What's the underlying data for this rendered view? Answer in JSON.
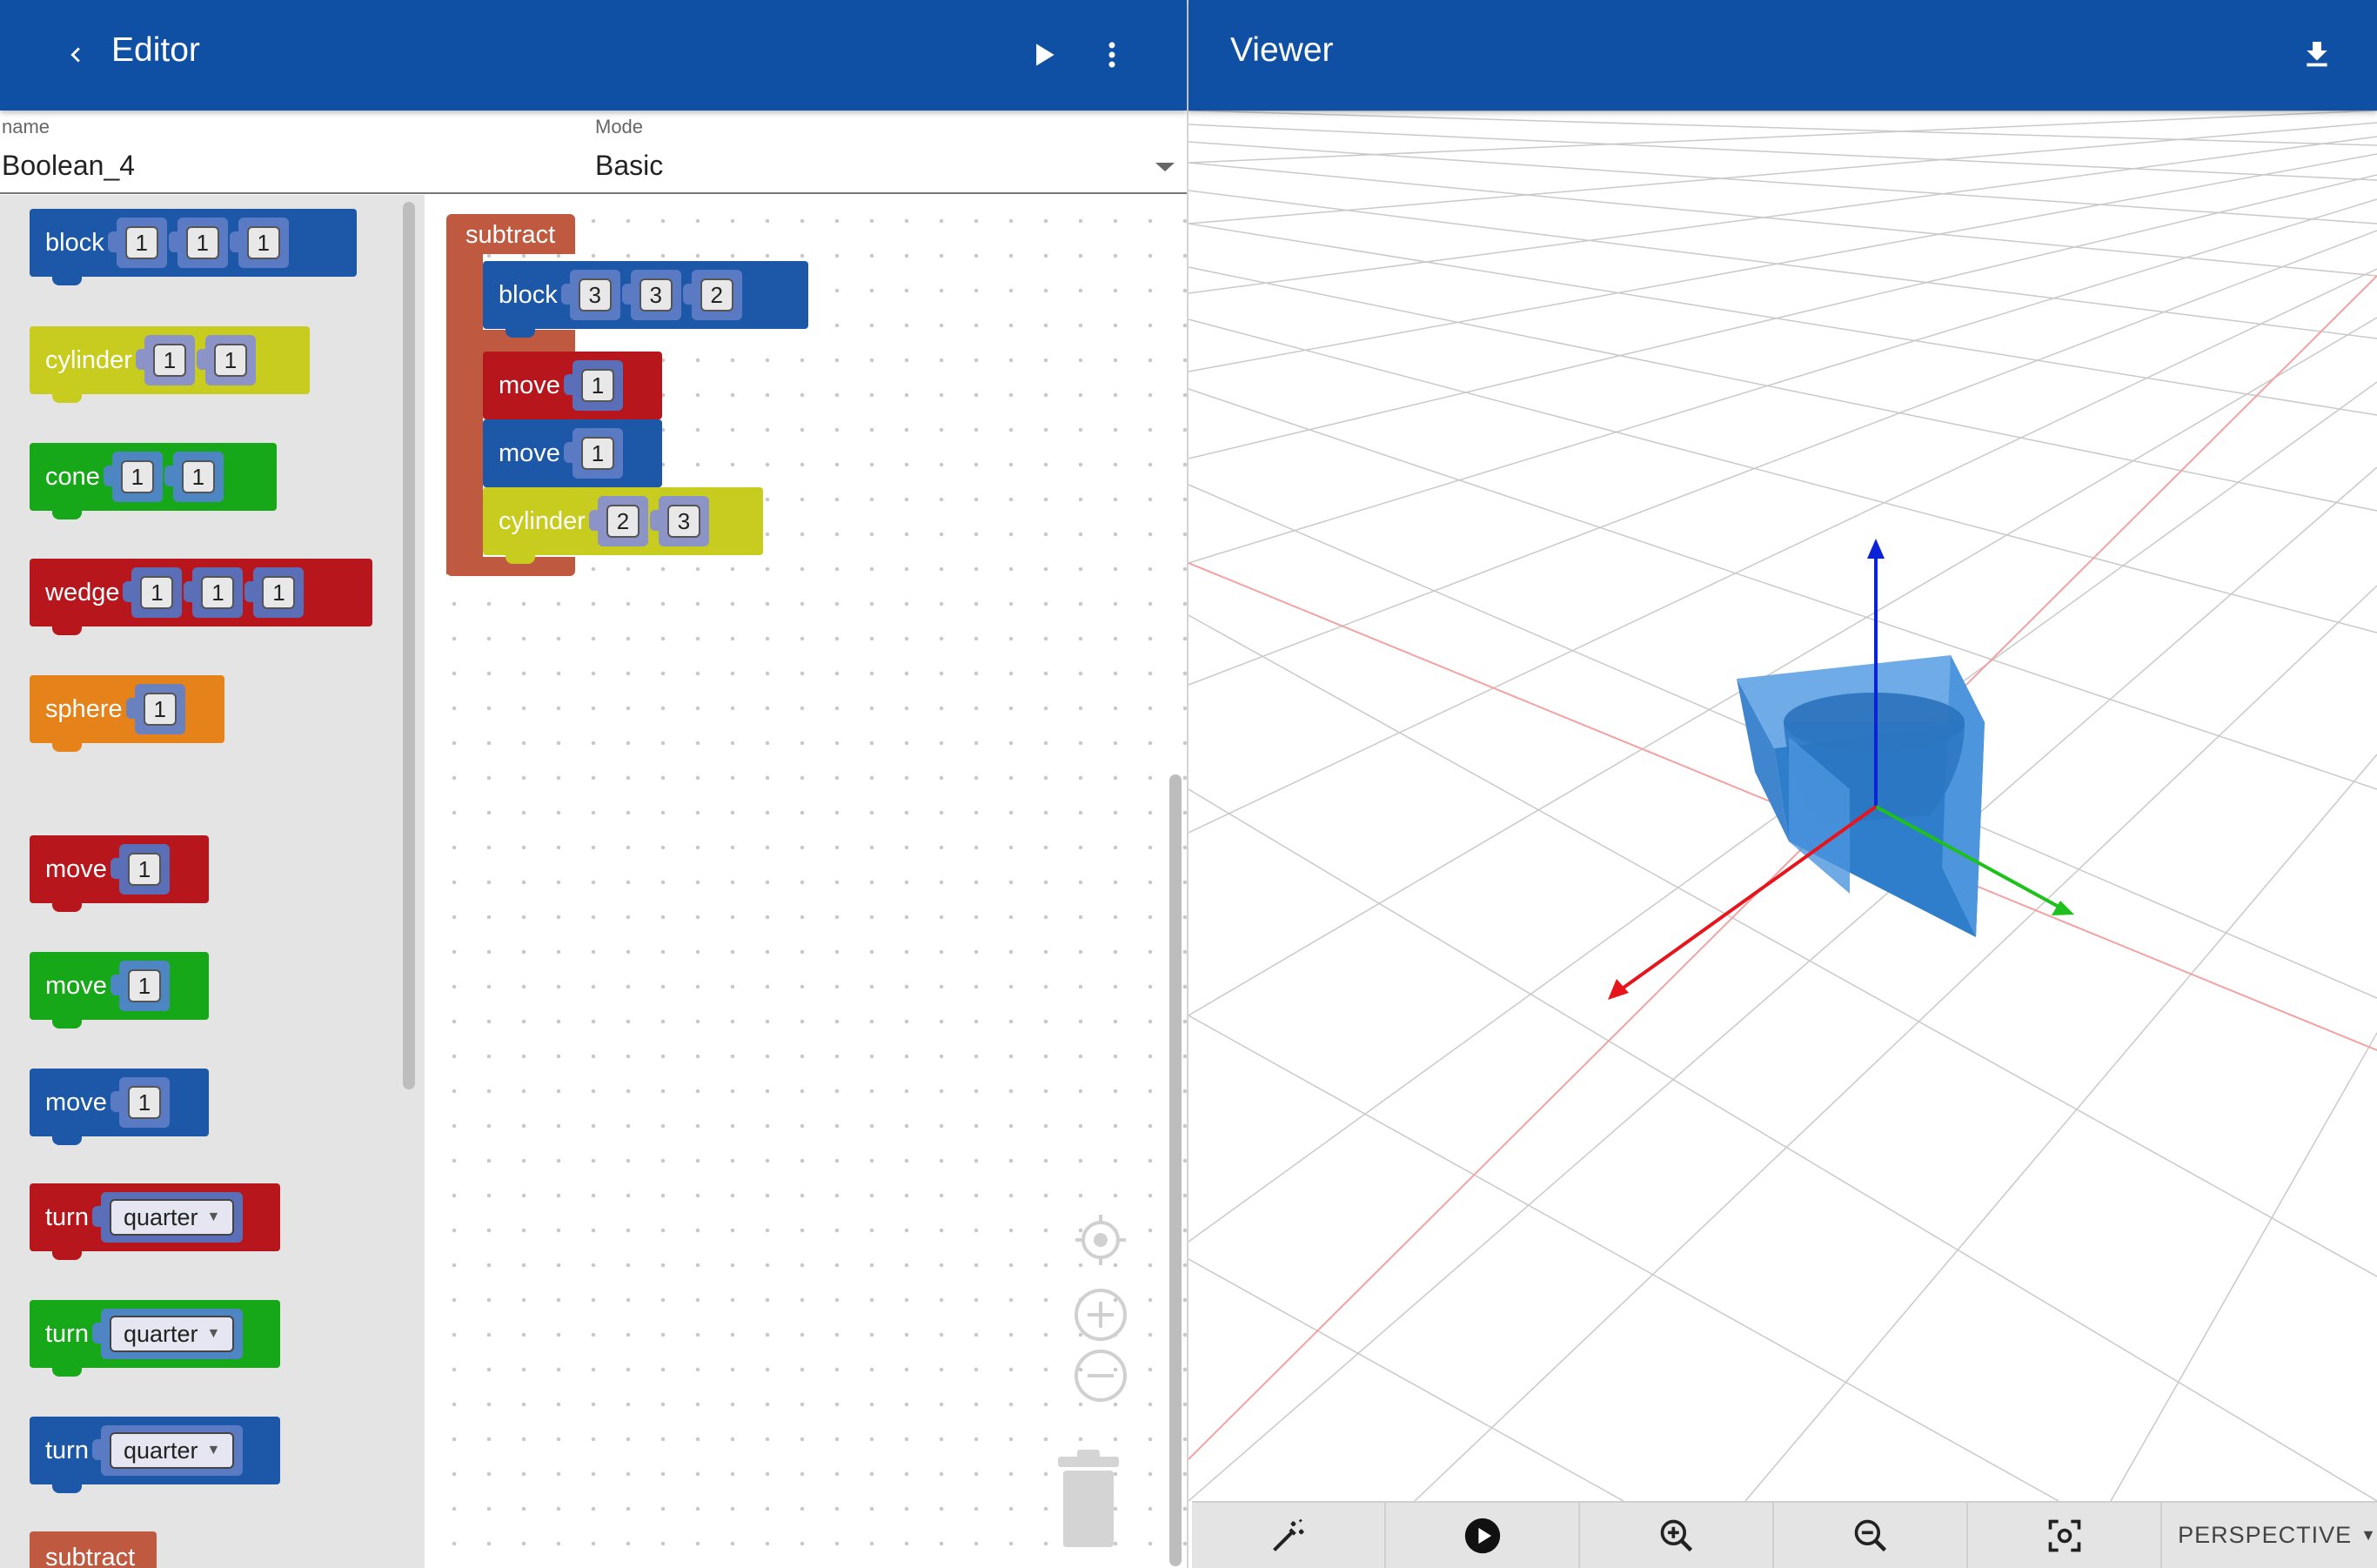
{
  "editor": {
    "title": "Editor",
    "name_field": {
      "label": "name",
      "value": "Boolean_4"
    },
    "mode_field": {
      "label": "Mode",
      "value": "Basic"
    },
    "toolbox": [
      {
        "label": "block",
        "color": "blue",
        "inputs": [
          "1",
          "1",
          "1"
        ]
      },
      {
        "label": "cylinder",
        "color": "yellow",
        "inputs": [
          "1",
          "1"
        ]
      },
      {
        "label": "cone",
        "color": "green",
        "inputs": [
          "1",
          "1"
        ]
      },
      {
        "label": "wedge",
        "color": "red",
        "inputs": [
          "1",
          "1",
          "1"
        ]
      },
      {
        "label": "sphere",
        "color": "orange",
        "inputs": [
          "1"
        ]
      },
      {
        "label": "move",
        "color": "red",
        "inputs": [
          "1"
        ]
      },
      {
        "label": "move",
        "color": "green",
        "inputs": [
          "1"
        ]
      },
      {
        "label": "move",
        "color": "blue",
        "inputs": [
          "1"
        ]
      },
      {
        "label": "turn",
        "color": "red",
        "dropdown": "quarter"
      },
      {
        "label": "turn",
        "color": "green",
        "dropdown": "quarter"
      },
      {
        "label": "turn",
        "color": "blue",
        "dropdown": "quarter"
      },
      {
        "label": "subtract",
        "color": "sub"
      }
    ],
    "workspace": {
      "container_label": "subtract",
      "children": [
        {
          "label": "block",
          "color": "blue",
          "inputs": [
            "3",
            "3",
            "2"
          ]
        },
        {
          "label": "move",
          "color": "red",
          "inputs": [
            "1"
          ]
        },
        {
          "label": "move",
          "color": "blue",
          "inputs": [
            "1"
          ]
        },
        {
          "label": "cylinder",
          "color": "yellow",
          "inputs": [
            "2",
            "3"
          ]
        }
      ]
    }
  },
  "viewer": {
    "title": "Viewer",
    "camera_mode": "PERSPECTIVE",
    "axis_colors": {
      "x": "#e8141b",
      "y": "#1ec11b",
      "z": "#0b23d6"
    },
    "model_color": "#3b8ddb"
  },
  "colors": {
    "appbar": "#0f50a5",
    "blue": "#1d58a8",
    "yellow": "#c7cc1f",
    "green": "#16a818",
    "red": "#b8161d",
    "orange": "#e5831a",
    "sub": "#bf5a41"
  }
}
